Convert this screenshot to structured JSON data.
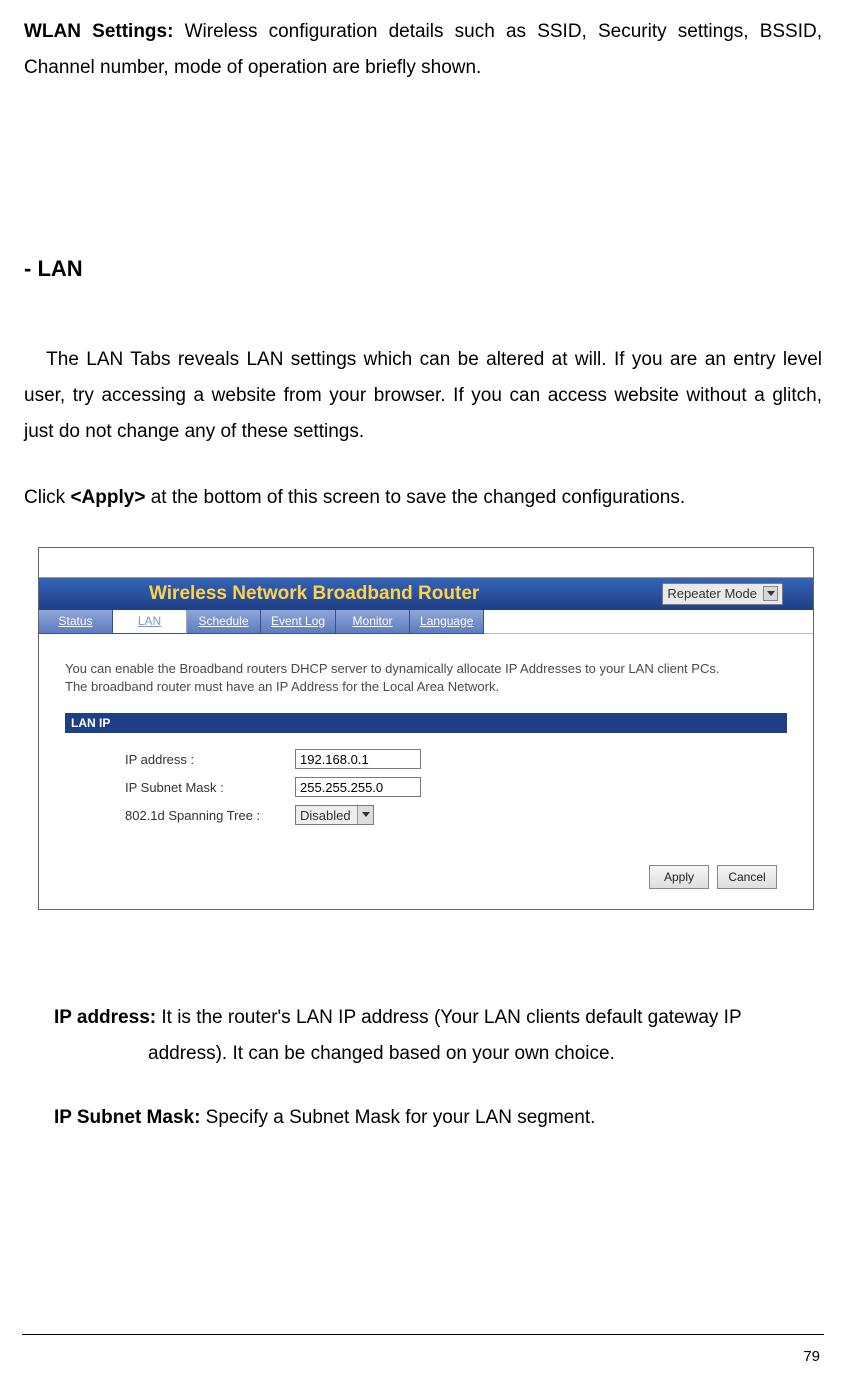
{
  "doc": {
    "wlan_para": {
      "label": "WLAN Settings:",
      "text": " Wireless configuration details such as SSID, Security settings, BSSID, Channel number, mode of operation are briefly shown."
    },
    "lan_heading": "- LAN",
    "lan_para": "   The LAN Tabs reveals LAN settings which can be altered at will. If you are an entry level user, try accessing a website from your browser. If you can access website without a glitch, just do not change any of these settings.",
    "apply_para_pre": "Click ",
    "apply_bold": "<Apply>",
    "apply_para_post": " at the bottom of this screen to save the changed configurations.",
    "ip_address": {
      "label": "IP address:",
      "text_l1": " It is the router's LAN IP address (Your LAN clients default gateway IP",
      "text_l2": "address). It can be changed based on your own choice."
    },
    "ip_subnet": {
      "label": "IP Subnet Mask:",
      "text": " Specify a Subnet Mask for your LAN segment."
    },
    "page_number": "79"
  },
  "router": {
    "title": "Wireless Network Broadband Router",
    "mode": "Repeater Mode",
    "tabs": [
      "Status",
      "LAN",
      "Schedule",
      "Event Log",
      "Monitor",
      "Language"
    ],
    "active_tab_index": 1,
    "help_text": "You can enable the Broadband routers DHCP server to dynamically allocate IP Addresses to your LAN client PCs. The broadband router must have an IP Address for the Local Area Network.",
    "section_label": "LAN IP",
    "form": {
      "ip_label": "IP address :",
      "ip_value": "192.168.0.1",
      "mask_label": "IP Subnet Mask :",
      "mask_value": "255.255.255.0",
      "spanning_label": "802.1d Spanning Tree :",
      "spanning_value": "Disabled"
    },
    "buttons": {
      "apply": "Apply",
      "cancel": "Cancel"
    }
  }
}
